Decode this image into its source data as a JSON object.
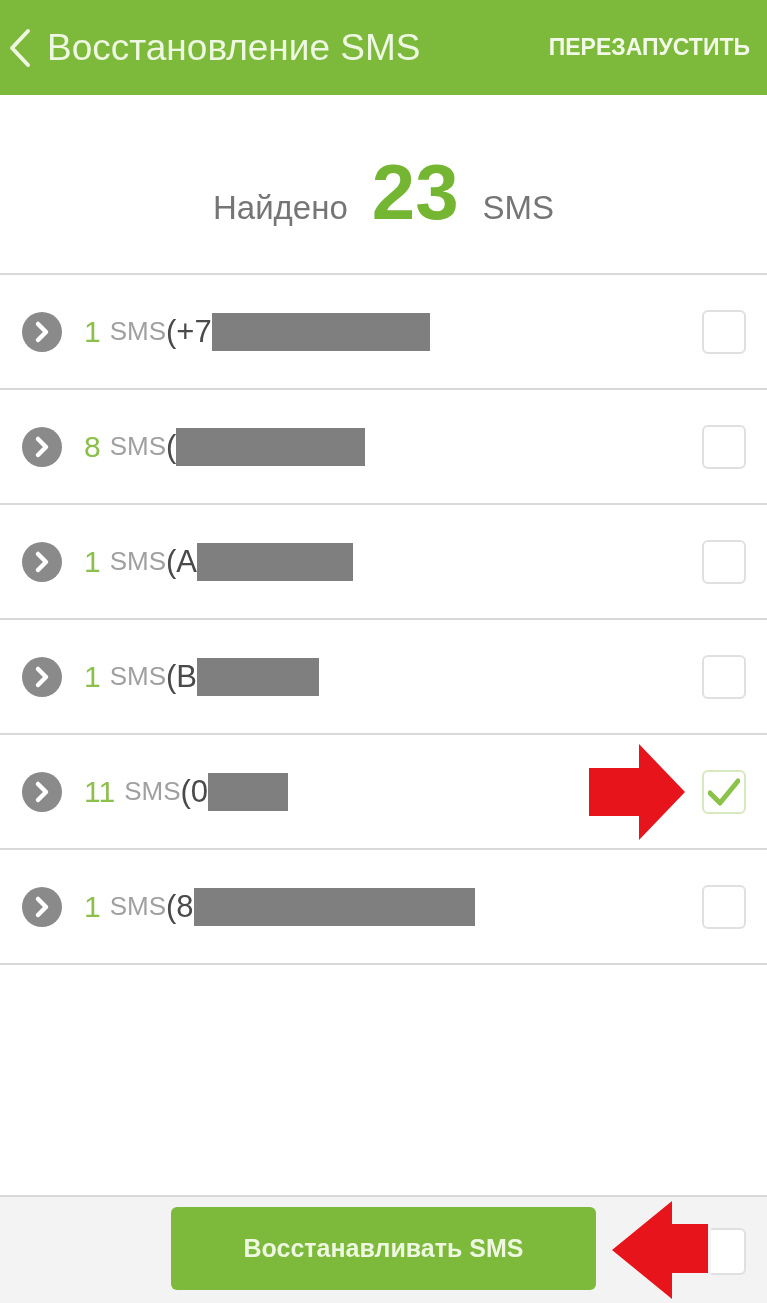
{
  "header": {
    "title": "Восстановление SMS",
    "action": "ПЕРЕЗАПУСТИТЬ"
  },
  "summary": {
    "prefix": "Найдено",
    "count": "23",
    "unit": "SMS"
  },
  "rows": [
    {
      "count": "1",
      "unit": "SMS",
      "contact": "(+7",
      "redacted": true,
      "checked": false,
      "arrow_annotation": false
    },
    {
      "count": "8",
      "unit": "SMS",
      "contact": "(",
      "redacted": true,
      "checked": false,
      "arrow_annotation": false
    },
    {
      "count": "1",
      "unit": "SMS",
      "contact": "(A",
      "redacted": true,
      "checked": false,
      "arrow_annotation": false
    },
    {
      "count": "1",
      "unit": "SMS",
      "contact": "(B",
      "redacted": true,
      "checked": false,
      "arrow_annotation": false
    },
    {
      "count": "11",
      "unit": "SMS",
      "contact": "(0",
      "redacted": true,
      "checked": true,
      "arrow_annotation": true
    },
    {
      "count": "1",
      "unit": "SMS",
      "contact": "(8",
      "redacted": true,
      "checked": false,
      "arrow_annotation": false
    }
  ],
  "bottom_bar": {
    "button": "Восстанавливать SMS",
    "select_all": {
      "checked": false
    },
    "arrow_annotation": true
  }
}
